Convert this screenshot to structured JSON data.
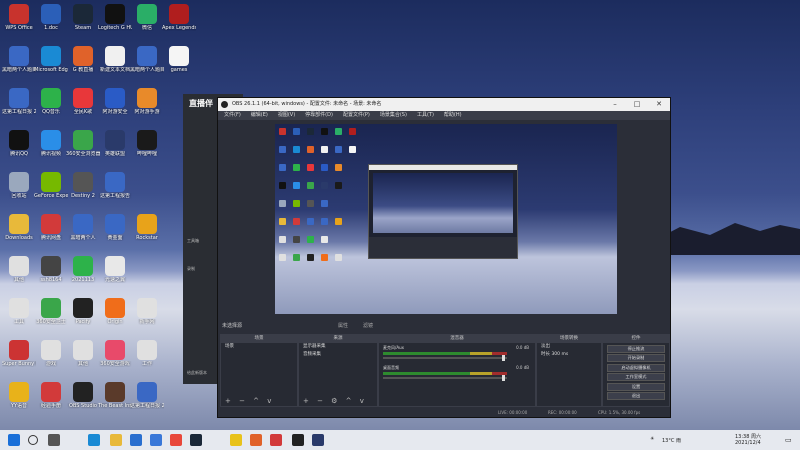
{
  "desktop": {
    "icons": [
      {
        "label": "WPS Office",
        "color": "#c8332d",
        "col": 0,
        "row": 0
      },
      {
        "label": "1.doc",
        "color": "#2b5fb8",
        "col": 1,
        "row": 0
      },
      {
        "label": "Steam",
        "color": "#1b2838",
        "col": 2,
        "row": 0
      },
      {
        "label": "Logitech G HUB",
        "color": "#111111",
        "col": 3,
        "row": 0
      },
      {
        "label": "微信",
        "color": "#2aae67",
        "col": 4,
        "row": 0
      },
      {
        "label": "Apex Legends",
        "color": "#b01e1e",
        "col": 5,
        "row": 0
      },
      {
        "label": "黑暗两个人题目",
        "color": "#3a68c4",
        "col": 0,
        "row": 1
      },
      {
        "label": "Microsoft Edge",
        "color": "#1a8ad4",
        "col": 1,
        "row": 1
      },
      {
        "label": "G 教直播",
        "color": "#e0622a",
        "col": 2,
        "row": 1
      },
      {
        "label": "新建文本文档",
        "color": "#f0f0f0",
        "col": 3,
        "row": 1
      },
      {
        "label": "黑暗两个人题目",
        "color": "#3a68c4",
        "col": 4,
        "row": 1
      },
      {
        "label": "games",
        "color": "#f5f5f5",
        "col": 5,
        "row": 1
      },
      {
        "label": "这第工程日报 20210504",
        "color": "#3a68c4",
        "col": 0,
        "row": 2
      },
      {
        "label": "QQ音乐",
        "color": "#2db24a",
        "col": 1,
        "row": 2
      },
      {
        "label": "全民K歌",
        "color": "#e8373a",
        "col": 2,
        "row": 2
      },
      {
        "label": "阿对游安全",
        "color": "#2a5bc6",
        "col": 3,
        "row": 2
      },
      {
        "label": "阿对游手游",
        "color": "#e88a2a",
        "col": 4,
        "row": 2
      },
      {
        "label": "腾讯QQ",
        "color": "#111111",
        "col": 0,
        "row": 3
      },
      {
        "label": "腾讯视频",
        "color": "#2a8ee8",
        "col": 1,
        "row": 3
      },
      {
        "label": "360安全浏览器",
        "color": "#3aa64a",
        "col": 2,
        "row": 3
      },
      {
        "label": "英雄联盟",
        "color": "#2a3a6a",
        "col": 3,
        "row": 3
      },
      {
        "label": "哔哩哔哩",
        "color": "#1a1a1a",
        "col": 4,
        "row": 3
      },
      {
        "label": "回收站",
        "color": "#9aa8bd",
        "col": 0,
        "row": 4
      },
      {
        "label": "GeForce Experience",
        "color": "#76b900",
        "col": 1,
        "row": 4
      },
      {
        "label": "Destiny 2",
        "color": "#555555",
        "col": 2,
        "row": 4
      },
      {
        "label": "这第工程报告",
        "color": "#3a68c4",
        "col": 3,
        "row": 4
      },
      {
        "label": "Downloads",
        "color": "#e8b93a",
        "col": 0,
        "row": 5
      },
      {
        "label": "腾讯网盘",
        "color": "#d23a3a",
        "col": 1,
        "row": 5
      },
      {
        "label": "黑暗两个人",
        "color": "#3a68c4",
        "col": 2,
        "row": 5
      },
      {
        "label": "黄金面",
        "color": "#3a68c4",
        "col": 3,
        "row": 5
      },
      {
        "label": "Rockstar",
        "color": "#e8a31a",
        "col": 4,
        "row": 5
      },
      {
        "label": "其他",
        "color": "#e0e0e0",
        "col": 0,
        "row": 6
      },
      {
        "label": "ssh8164",
        "color": "#444444",
        "col": 1,
        "row": 6
      },
      {
        "label": "2021113",
        "color": "#2db24a",
        "col": 2,
        "row": 6
      },
      {
        "label": "光速之翼",
        "color": "#e8e8e8",
        "col": 3,
        "row": 6
      },
      {
        "label": "工具",
        "color": "#e0e0e0",
        "col": 0,
        "row": 7
      },
      {
        "label": "360安全卫士",
        "color": "#3aa64a",
        "col": 1,
        "row": 7
      },
      {
        "label": "Pacify",
        "color": "#222222",
        "col": 2,
        "row": 7
      },
      {
        "label": "Origin",
        "color": "#f06d1a",
        "col": 3,
        "row": 7
      },
      {
        "label": "新手网",
        "color": "#e0e0e0",
        "col": 4,
        "row": 7
      },
      {
        "label": "Super Bunny Ball",
        "color": "#cc3333",
        "col": 0,
        "row": 8
      },
      {
        "label": "游戏",
        "color": "#e0e0e0",
        "col": 1,
        "row": 8
      },
      {
        "label": "其他",
        "color": "#e0e0e0",
        "col": 2,
        "row": 8
      },
      {
        "label": "360安全游戏",
        "color": "#e84a6a",
        "col": 3,
        "row": 8
      },
      {
        "label": "工作",
        "color": "#e0e0e0",
        "col": 4,
        "row": 8
      },
      {
        "label": "YY语音",
        "color": "#e8b21a",
        "col": 0,
        "row": 9
      },
      {
        "label": "经验手册",
        "color": "#d23a3a",
        "col": 1,
        "row": 9
      },
      {
        "label": "OBS Studio",
        "color": "#222222",
        "col": 2,
        "row": 9
      },
      {
        "label": "The Beast Inside",
        "color": "#5a3a2a",
        "col": 3,
        "row": 9
      },
      {
        "label": "这第工程日报 20210503",
        "color": "#3a68c4",
        "col": 4,
        "row": 9
      }
    ]
  },
  "bg_app": {
    "title": "直播伴",
    "tools_label": "工具箱",
    "record_label": "录制",
    "version_label": "给此新版本"
  },
  "obs": {
    "title": "OBS 26.1.1 (64-bit, windows) - 配置文件: 未命名 - 场景: 未命名",
    "menu": [
      "文件(F)",
      "编辑(E)",
      "视图(V)",
      "停靠部件(D)",
      "配置文件(P)",
      "场景集合(S)",
      "工具(T)",
      "帮助(H)"
    ],
    "scene_header_label": "未选择源",
    "properties_label": "属性",
    "filters_label": "滤镜",
    "docks": {
      "scenes": {
        "title": "场景",
        "items": [
          "场景"
        ]
      },
      "sources": {
        "title": "来源",
        "items": [
          "显示器采集",
          "音频采集"
        ]
      },
      "mixer": {
        "title": "混音器",
        "channels": [
          {
            "name": "麦克风/Aux",
            "db": "0.0 dB",
            "level": 0.96
          },
          {
            "name": "桌面音频",
            "db": "0.0 dB",
            "level": 0.96
          }
        ]
      },
      "transitions": {
        "title": "场景转换",
        "type": "淡出",
        "duration_label": "时长",
        "duration": "300 ms"
      },
      "controls": {
        "title": "控件",
        "buttons": [
          "停止推流",
          "开始录制",
          "启动虚拟摄像机",
          "工作室模式",
          "设置",
          "退出"
        ]
      }
    },
    "status": {
      "live": "LIVE: 00:00:00",
      "rec": "REC: 00:00:00",
      "cpu": "CPU: 1.5%, 30.00 fps"
    }
  },
  "taskbar": {
    "weather": "13°C 雨",
    "time": "13:38 周六",
    "date": "2021/12/4"
  }
}
